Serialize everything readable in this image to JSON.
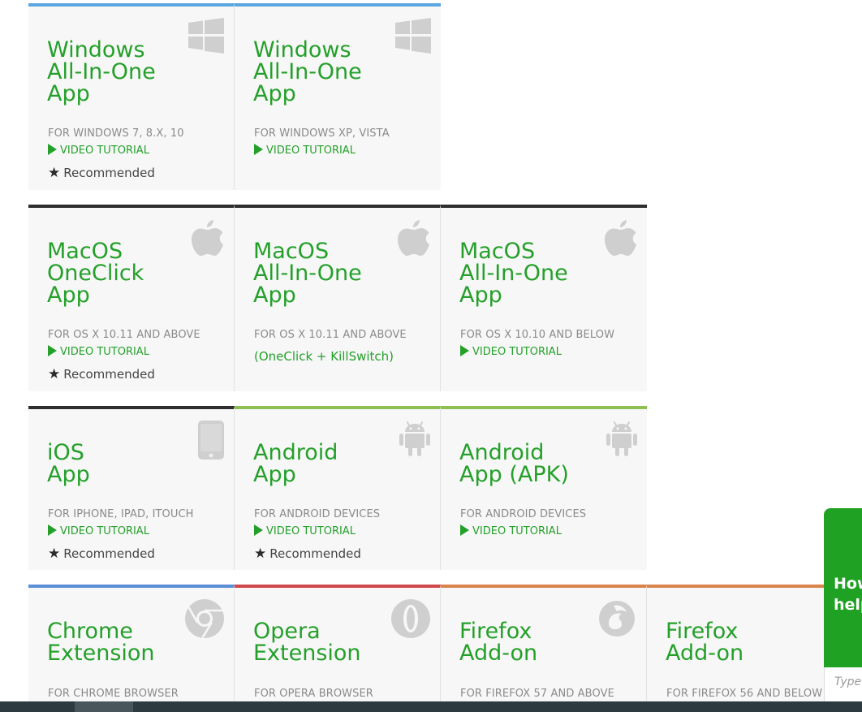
{
  "colors": {
    "windows": "#5aa7e0",
    "dark": "#2e2e2e",
    "android": "#8cc152",
    "chrome": "#5b8fd6",
    "opera": "#d0474c",
    "firefox": "#d9844a",
    "green": "#24a02a"
  },
  "cards": [
    {
      "title": "Windows\nAll-In-One\nApp",
      "sub": "FOR WINDOWS 7, 8.X, 10",
      "video": "VIDEO TUTORIAL",
      "rec": "Recommended",
      "icon": "windows-icon"
    },
    {
      "title": "Windows\nAll-In-One\nApp",
      "sub": "FOR WINDOWS XP, VISTA",
      "video": "VIDEO TUTORIAL",
      "icon": "windows-icon"
    },
    {
      "title": "MacOS\nOneClick\nApp",
      "sub": "FOR OS X 10.11 AND ABOVE",
      "video": "VIDEO TUTORIAL",
      "rec": "Recommended",
      "icon": "apple-icon"
    },
    {
      "title": "MacOS\nAll-In-One\nApp",
      "sub": "FOR OS X 10.11 AND ABOVE",
      "extra": "(OneClick + KillSwitch)",
      "icon": "apple-icon"
    },
    {
      "title": "MacOS\nAll-In-One\nApp",
      "sub": "FOR OS X 10.10 AND BELOW",
      "video": "VIDEO TUTORIAL",
      "icon": "apple-icon"
    },
    {
      "title": "iOS\nApp",
      "sub": "FOR IPHONE, IPAD, ITOUCH",
      "video": "VIDEO TUTORIAL",
      "rec": "Recommended",
      "icon": "phone-icon"
    },
    {
      "title": "Android\nApp",
      "sub": "FOR ANDROID DEVICES",
      "video": "VIDEO TUTORIAL",
      "rec": "Recommended",
      "icon": "android-icon"
    },
    {
      "title": "Android\nApp (APK)",
      "sub": "FOR ANDROID DEVICES",
      "video": "VIDEO TUTORIAL",
      "icon": "android-icon"
    },
    {
      "title": "Chrome\nExtension",
      "sub": "FOR CHROME BROWSER",
      "icon": "chrome-icon"
    },
    {
      "title": "Opera\nExtension",
      "sub": "FOR OPERA BROWSER",
      "icon": "opera-icon"
    },
    {
      "title": "Firefox\nAdd-on",
      "sub": "FOR FIREFOX 57 AND ABOVE",
      "icon": "firefox-icon"
    },
    {
      "title": "Firefox\nAdd-on",
      "sub": "FOR FIREFOX 56 AND BELOW",
      "icon": "firefox-icon"
    }
  ],
  "chat": {
    "message": "How\nhelp",
    "placeholder": "Type"
  }
}
